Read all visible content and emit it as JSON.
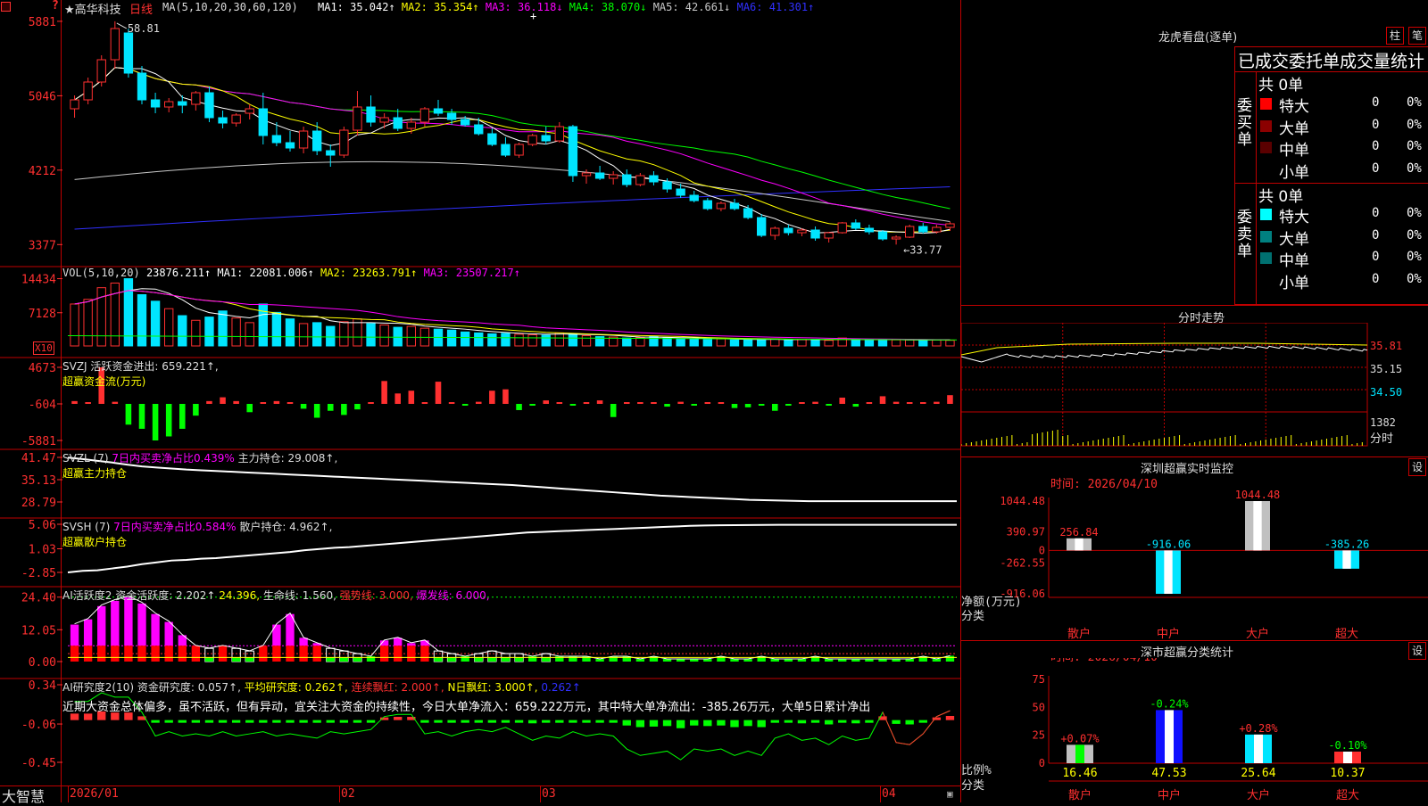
{
  "colors": {
    "up": "#ff3030",
    "down": "#00e5ff",
    "border": "#c00000",
    "ma1": "#ffffff",
    "ma2": "#ffff00",
    "ma3": "#ff00ff",
    "ma4": "#00ff00",
    "ma5": "#c8c8c8",
    "ma6": "#3030ff",
    "positive": "#ff3030",
    "negative": "#00ff00"
  },
  "header": {
    "corner_icon": "square-icon",
    "marker": "?",
    "stock_name": "★高华科技",
    "period": "日线",
    "ma_label": "MA(5,10,20,30,60,120)",
    "ma_values": [
      {
        "text": "MA1: 35.042↑",
        "color": "#ffffff"
      },
      {
        "text": "MA2: 35.354↑",
        "color": "#ffff00"
      },
      {
        "text": "MA3: 36.118↓",
        "color": "#ff00ff"
      },
      {
        "text": "MA4: 38.070↓",
        "color": "#00ff00"
      },
      {
        "text": "MA5: 42.661↓",
        "color": "#c8c8c8"
      },
      {
        "text": "MA6: 41.301↑",
        "color": "#3030ff"
      }
    ]
  },
  "price_axis": [
    "5881",
    "5046",
    "4212",
    "3377"
  ],
  "price_high_label": "58.81",
  "price_low_label": "33.77",
  "vol": {
    "title": "VOL(5,10,20)",
    "value": "23876.211↑",
    "ma": [
      {
        "text": "MA1: 22081.006↑",
        "color": "#ffffff"
      },
      {
        "text": "MA2: 23263.791↑",
        "color": "#ffff00"
      },
      {
        "text": "MA3: 23507.217↑",
        "color": "#ff00ff"
      }
    ],
    "axis": [
      "14434",
      "7128"
    ],
    "unit": "X10"
  },
  "svzj": {
    "title": "SVZJ  活跃资金进出: 659.221↑,",
    "subtitle": "超赢资金流(万元)",
    "axis": [
      "4673",
      "-604",
      "-5881"
    ]
  },
  "svzl": {
    "title_a": "SVZL (7) ",
    "title_b": "7日内买卖净占比0.439%",
    "title_c": " 主力持仓: 29.008↑,",
    "subtitle": "超赢主力持仓",
    "axis": [
      "41.47",
      "35.13",
      "28.79"
    ]
  },
  "svsh": {
    "title_a": "SVSH (7) ",
    "title_b": "7日内买卖净占比0.584%",
    "title_c": " 散户持仓: 4.962↑,",
    "subtitle": "超赢散户持仓",
    "axis": [
      "5.06",
      "1.03",
      "-2.85"
    ]
  },
  "ai_active": {
    "title_a": "AI活跃度2 资金活跃度: 2.202↑",
    "title_b": " 24.396,",
    "title_c": " 生命线: 1.560,",
    "title_d": " 强势线: 3.000,",
    "title_e": " 爆发线: 6.000,",
    "axis": [
      "24.40",
      "12.05",
      "0.00"
    ]
  },
  "ai_research": {
    "title_a": "AI研究度2(10) 资金研究度: 0.057↑,",
    "title_b": " 平均研究度: 0.262↑,",
    "title_c": " 连续飘红: 2.000↑,",
    "title_d": " N日飘红: 3.000↑,",
    "title_e": " 0.262↑",
    "comment": "近期大资金总体偏多，虽不活跃，但有异动，宜关注大资金的持续性，今日大单净流入：659.222万元，其中特大单净流出：-385.26万元，大单5日累计净出",
    "axis": [
      "0.34",
      "-0.06",
      "-0.45"
    ]
  },
  "footer": {
    "brand": "大智慧",
    "dates": [
      "2026/01",
      "02",
      "03",
      "04"
    ],
    "lock_icon": "lock-icon"
  },
  "dragon_tiger": {
    "title": "龙虎看盘(逐单)",
    "btn_a": "柱",
    "btn_b": "笔",
    "header": "已成交委托单成交量统计",
    "buy_label": "委买单",
    "sell_label": "委卖单",
    "buy_total": "共 0单",
    "sell_total": "共 0单",
    "buy_rows": [
      {
        "label": "特大",
        "count": "0",
        "pct": "0%",
        "color": "#ff0000"
      },
      {
        "label": "大单",
        "count": "0",
        "pct": "0%",
        "color": "#8b0000"
      },
      {
        "label": "中单",
        "count": "0",
        "pct": "0%",
        "color": "#5a0000"
      },
      {
        "label": "小单",
        "count": "0",
        "pct": "0%",
        "color": "#000000"
      }
    ],
    "sell_rows": [
      {
        "label": "特大",
        "count": "0",
        "pct": "0%",
        "color": "#00ffff"
      },
      {
        "label": "大单",
        "count": "0",
        "pct": "0%",
        "color": "#008080"
      },
      {
        "label": "中单",
        "count": "0",
        "pct": "0%",
        "color": "#007070"
      },
      {
        "label": "小单",
        "count": "0",
        "pct": "0%",
        "color": "#000000"
      }
    ]
  },
  "intraday": {
    "title": "分时走势",
    "axis": [
      "35.81",
      "35.15",
      "34.50"
    ],
    "vol_axis": "1382",
    "vol_label": "分时"
  },
  "sz_monitor": {
    "title": "深圳超赢实时监控",
    "btn": "设",
    "time": "时间: 2026/04/10",
    "axis": [
      "1044.48",
      "390.97",
      "0",
      "-262.55",
      "-916.06"
    ],
    "ylabel": "净额(万元)",
    "xlabel": "分类",
    "categories": [
      "散户",
      "中户",
      "大户",
      "超大"
    ],
    "values": [
      256.84,
      -916.06,
      1044.48,
      -385.26
    ],
    "value_labels": [
      "256.84",
      "-916.06",
      "1044.48",
      "-385.26"
    ]
  },
  "sz_class": {
    "title": "深市超赢分类统计",
    "btn": "设",
    "time": "时间: 2026/04/10",
    "axis": [
      "75",
      "50",
      "25",
      "0"
    ],
    "ylabel": "比例%",
    "xlabel": "分类",
    "categories": [
      "散户",
      "中户",
      "大户",
      "超大"
    ],
    "values": [
      16.46,
      47.53,
      25.64,
      10.37
    ],
    "value_labels": [
      "16.46",
      "47.53",
      "25.64",
      "10.37"
    ],
    "changes": [
      "+0.07%",
      "-0.24%",
      "+0.28%",
      "-0.10%"
    ]
  },
  "chart_data": {
    "type": "candlestick",
    "period": "日线",
    "x_labels": [
      "2026/01",
      "02",
      "03",
      "04"
    ],
    "ohlc": [
      [
        49.0,
        50.5,
        48.0,
        50.0
      ],
      [
        50.0,
        52.5,
        49.5,
        52.0
      ],
      [
        52.0,
        55.0,
        51.5,
        54.5
      ],
      [
        54.5,
        58.81,
        53.5,
        58.0
      ],
      [
        57.5,
        58.0,
        52.5,
        53.0
      ],
      [
        53.0,
        53.8,
        49.5,
        50.0
      ],
      [
        50.0,
        50.8,
        48.5,
        49.2
      ],
      [
        49.2,
        50.2,
        48.6,
        49.8
      ],
      [
        49.8,
        50.5,
        48.5,
        49.4
      ],
      [
        49.5,
        51.0,
        48.8,
        50.8
      ],
      [
        50.8,
        51.5,
        47.5,
        48.0
      ],
      [
        48.0,
        48.8,
        46.8,
        47.4
      ],
      [
        47.4,
        48.5,
        47.0,
        48.3
      ],
      [
        48.5,
        49.5,
        47.8,
        49.0
      ],
      [
        49.0,
        50.8,
        45.0,
        46.0
      ],
      [
        46.0,
        47.5,
        44.8,
        45.2
      ],
      [
        45.2,
        46.5,
        44.2,
        44.6
      ],
      [
        44.6,
        47.0,
        44.0,
        46.5
      ],
      [
        46.5,
        47.5,
        43.8,
        44.3
      ],
      [
        44.3,
        45.0,
        42.5,
        43.8
      ],
      [
        43.8,
        47.0,
        43.5,
        46.6
      ],
      [
        46.6,
        51.0,
        46.0,
        49.2
      ],
      [
        49.2,
        50.5,
        47.0,
        47.5
      ],
      [
        47.5,
        48.5,
        46.8,
        48.0
      ],
      [
        48.0,
        49.0,
        46.5,
        46.8
      ],
      [
        46.8,
        48.0,
        46.2,
        47.5
      ],
      [
        47.5,
        49.2,
        47.0,
        49.0
      ],
      [
        49.0,
        50.0,
        48.2,
        48.5
      ],
      [
        48.5,
        49.0,
        47.2,
        47.8
      ],
      [
        47.8,
        48.2,
        47.0,
        47.2
      ],
      [
        47.2,
        48.0,
        46.0,
        46.2
      ],
      [
        46.2,
        46.8,
        44.8,
        45.0
      ],
      [
        45.0,
        45.8,
        43.6,
        43.8
      ],
      [
        43.8,
        45.2,
        43.5,
        45.0
      ],
      [
        45.0,
        46.2,
        44.8,
        46.0
      ],
      [
        46.0,
        47.0,
        45.0,
        45.4
      ],
      [
        45.4,
        47.5,
        45.2,
        47.0
      ],
      [
        47.0,
        47.2,
        40.8,
        41.5
      ],
      [
        41.5,
        42.2,
        40.6,
        41.8
      ],
      [
        41.8,
        42.6,
        41.0,
        41.2
      ],
      [
        41.2,
        42.0,
        40.5,
        41.6
      ],
      [
        41.6,
        42.2,
        40.2,
        40.5
      ],
      [
        40.5,
        41.8,
        40.3,
        41.5
      ],
      [
        41.5,
        42.0,
        40.4,
        40.8
      ],
      [
        40.8,
        41.2,
        39.6,
        40.0
      ],
      [
        40.0,
        40.6,
        39.0,
        39.3
      ],
      [
        39.3,
        39.8,
        38.5,
        38.7
      ],
      [
        38.7,
        39.0,
        37.6,
        37.8
      ],
      [
        37.8,
        38.6,
        37.5,
        38.4
      ],
      [
        38.4,
        38.9,
        37.6,
        37.8
      ],
      [
        37.8,
        38.2,
        36.6,
        36.8
      ],
      [
        36.8,
        37.2,
        34.6,
        34.8
      ],
      [
        34.8,
        35.8,
        34.3,
        35.6
      ],
      [
        35.6,
        36.0,
        34.8,
        35.1
      ],
      [
        35.1,
        35.6,
        34.7,
        35.4
      ],
      [
        35.4,
        35.8,
        34.2,
        34.5
      ],
      [
        34.5,
        35.2,
        34.0,
        35.1
      ],
      [
        35.1,
        36.3,
        35.0,
        36.2
      ],
      [
        36.2,
        36.6,
        35.4,
        35.6
      ],
      [
        35.6,
        36.0,
        34.9,
        35.2
      ],
      [
        35.2,
        35.4,
        34.2,
        34.4
      ],
      [
        34.4,
        34.8,
        33.77,
        34.6
      ],
      [
        34.6,
        36.0,
        34.5,
        35.8
      ],
      [
        35.8,
        36.2,
        35.0,
        35.2
      ],
      [
        35.2,
        36.0,
        35.0,
        35.7
      ],
      [
        35.7,
        36.3,
        35.3,
        36.1
      ]
    ],
    "ma5_last": 35.042,
    "ma10_last": 35.354,
    "ma20_last": 36.118,
    "ma30_last": 38.07,
    "ma60_last": 42.661,
    "ma120_last": 41.301,
    "volume": [
      9000,
      10000,
      12500,
      13500,
      14434,
      11000,
      9600,
      8000,
      6500,
      5500,
      6200,
      7500,
      6000,
      5000,
      9000,
      7200,
      5800,
      4800,
      5000,
      4200,
      5200,
      5800,
      4800,
      4500,
      4000,
      4200,
      3800,
      3600,
      3400,
      3000,
      2800,
      2600,
      2700,
      2500,
      2400,
      2300,
      2800,
      2600,
      2200,
      2000,
      1900,
      1700,
      1800,
      2000,
      1800,
      1600,
      1500,
      1400,
      1500,
      1300,
      1400,
      1300,
      1500,
      1300,
      1400,
      1400,
      1200,
      1700,
      1400,
      1200,
      1200,
      1300,
      1300,
      1300,
      1300,
      1200
    ],
    "volume_unit": "X10",
    "fund_flow": [
      -200,
      -550,
      4673,
      -300,
      -3600,
      -4200,
      -5881,
      -5300,
      -4200,
      -2300,
      -200,
      350,
      -200,
      -1800,
      -600,
      -200,
      -500,
      -1300,
      -2600,
      -1600,
      -2200,
      -1400,
      -400,
      2700,
      900,
      1300,
      -600,
      2600,
      -500,
      -700,
      -300,
      1300,
      1500,
      -1500,
      -700,
      -100,
      -500,
      -700,
      -500,
      -100,
      -2500,
      -400,
      -500,
      -600,
      -1000,
      -300,
      -800,
      -600,
      -500,
      -1200,
      -1100,
      -700,
      -1600,
      -800,
      -500,
      -300,
      -800,
      300,
      -1000,
      -400,
      500,
      -300,
      -400,
      -500,
      -300,
      659
    ],
    "svzl_line": [
      41.4,
      41.0,
      40.5,
      40.0,
      39.4,
      38.9,
      38.6,
      38.3,
      38.0,
      37.8,
      37.6,
      37.4,
      37.2,
      37.0,
      36.8,
      36.6,
      36.4,
      36.2,
      36.0,
      35.8,
      35.6,
      35.4,
      35.2,
      35.0,
      34.8,
      34.6,
      34.4,
      34.2,
      34.0,
      33.8,
      33.6,
      33.3,
      33.0,
      32.7,
      32.4,
      32.1,
      31.8,
      31.5,
      31.2,
      30.9,
      30.6,
      30.4,
      30.2,
      30.0,
      29.8,
      29.6,
      29.4,
      29.3,
      29.2,
      29.1,
      29.0,
      29.0,
      29.0,
      29.0,
      29.0,
      29.0,
      29.0,
      29.0,
      29.0,
      29.0,
      29.008
    ],
    "svsh_line": [
      -2.85,
      -2.6,
      -2.5,
      -2.2,
      -1.9,
      -1.5,
      -1.2,
      -0.9,
      -0.8,
      -0.6,
      -0.5,
      -0.3,
      -0.1,
      0.1,
      0.3,
      0.5,
      0.8,
      1.0,
      1.2,
      1.3,
      1.5,
      1.7,
      1.9,
      2.1,
      2.3,
      2.5,
      2.7,
      2.9,
      3.1,
      3.3,
      3.5,
      3.7,
      3.8,
      3.9,
      4.0,
      4.1,
      4.2,
      4.3,
      4.4,
      4.5,
      4.6,
      4.7,
      4.8,
      4.85,
      4.9,
      4.92,
      4.94,
      4.95,
      4.96,
      4.962,
      4.962,
      4.962,
      4.962,
      4.962,
      4.962,
      4.962,
      4.962,
      4.962,
      4.962,
      4.962,
      4.962
    ],
    "ai_active_bars": [
      14,
      16,
      21,
      23,
      24.4,
      22,
      18,
      15,
      10,
      6,
      5,
      6,
      5,
      4,
      6,
      14,
      18,
      9,
      7,
      5,
      4,
      3,
      2,
      8,
      9,
      7,
      8,
      4,
      3,
      2,
      3,
      4,
      3,
      3,
      2,
      3,
      2,
      2,
      2,
      1,
      2,
      2,
      1,
      2,
      1,
      1,
      1,
      1,
      2,
      1,
      1,
      2,
      1,
      1,
      1,
      2,
      1,
      1,
      1,
      1,
      1,
      1,
      1,
      2,
      1,
      2.2
    ],
    "ai_research_bars": [
      0.1,
      0.1,
      0.14,
      0.12,
      0.12,
      0.05,
      -0.06,
      -0.04,
      -0.06,
      -0.05,
      -0.06,
      -0.04,
      -0.06,
      -0.05,
      -0.04,
      -0.06,
      -0.05,
      -0.06,
      -0.07,
      -0.04,
      -0.05,
      -0.04,
      -0.03,
      0.03,
      0.04,
      0.04,
      -0.05,
      -0.04,
      -0.06,
      -0.04,
      -0.03,
      -0.04,
      -0.02,
      -0.05,
      -0.08,
      -0.06,
      -0.07,
      -0.04,
      -0.06,
      -0.05,
      -0.06,
      -0.12,
      -0.15,
      -0.14,
      -0.13,
      -0.17,
      -0.12,
      -0.13,
      -0.12,
      -0.15,
      -0.13,
      -0.15,
      -0.07,
      -0.05,
      -0.08,
      -0.07,
      -0.1,
      -0.06,
      -0.08,
      -0.07,
      0.05,
      -0.09,
      -0.1,
      -0.05,
      0.03,
      0.057
    ]
  }
}
